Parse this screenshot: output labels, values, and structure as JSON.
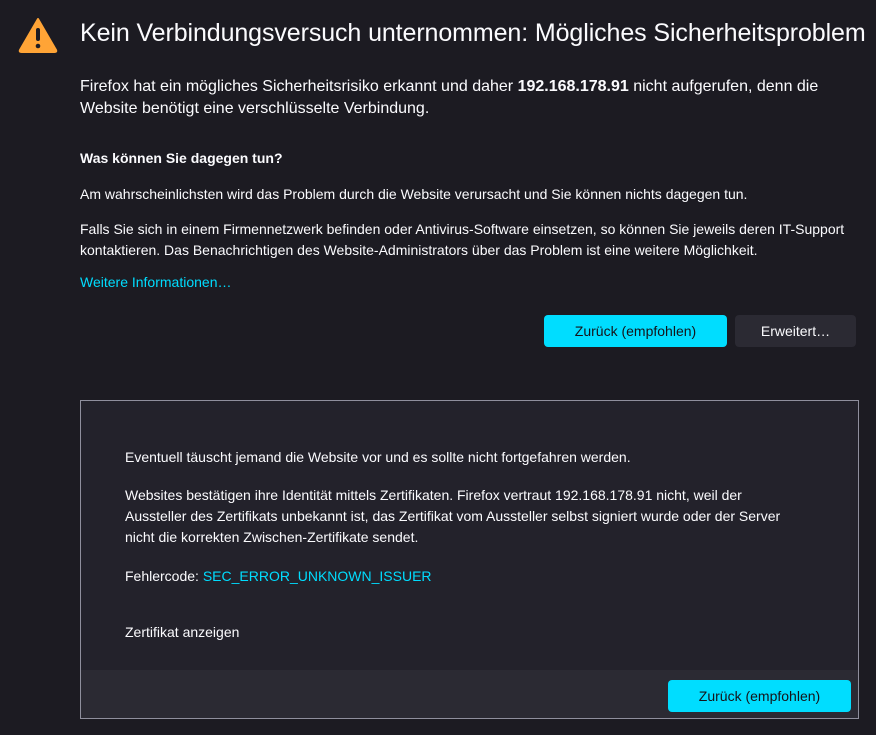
{
  "page": {
    "title": "Kein Verbindungsversuch unternommen: Mögliches Sicherheitsproblem",
    "intro_before": "Firefox hat ein mögliches Sicherheitsrisiko erkannt und daher ",
    "intro_host": "192.168.178.91",
    "intro_after": " nicht aufgerufen, denn die Website benötigt eine verschlüsselte Verbindung.",
    "what_to_do_heading": "Was können Sie dagegen tun?",
    "para1": "Am wahrscheinlichsten wird das Problem durch die Website verursacht und Sie können nichts dagegen tun.",
    "para2": "Falls Sie sich in einem Firmennetzwerk befinden oder Antivirus-Software einsetzen, so können Sie jeweils deren IT-Support kontaktieren. Das Benachrichtigen des Website-Administrators über das Problem ist eine weitere Möglichkeit.",
    "learn_more": "Weitere Informationen…",
    "back_button": "Zurück (empfohlen)",
    "advanced_button": "Erweitert…"
  },
  "advanced": {
    "p1": "Eventuell täuscht jemand die Website vor und es sollte nicht fortgefahren werden.",
    "p2": "Websites bestätigen ihre Identität mittels Zertifikaten. Firefox vertraut 192.168.178.91 nicht, weil der Aussteller des Zertifikats unbekannt ist, das Zertifikat vom Aussteller selbst signiert wurde oder der Server nicht die korrekten Zwischen-Zertifikate sendet.",
    "error_label": "Fehlercode: ",
    "error_code": "SEC_ERROR_UNKNOWN_ISSUER",
    "view_certificate": "Zertifikat anzeigen",
    "back_button": "Zurück (empfohlen)"
  },
  "icons": {
    "warning": "warning-triangle-icon"
  },
  "colors": {
    "background": "#1c1b22",
    "accent": "#00ddff",
    "warning": "#ffa436",
    "panel": "#23222b",
    "panel_footer": "#2b2a33"
  }
}
